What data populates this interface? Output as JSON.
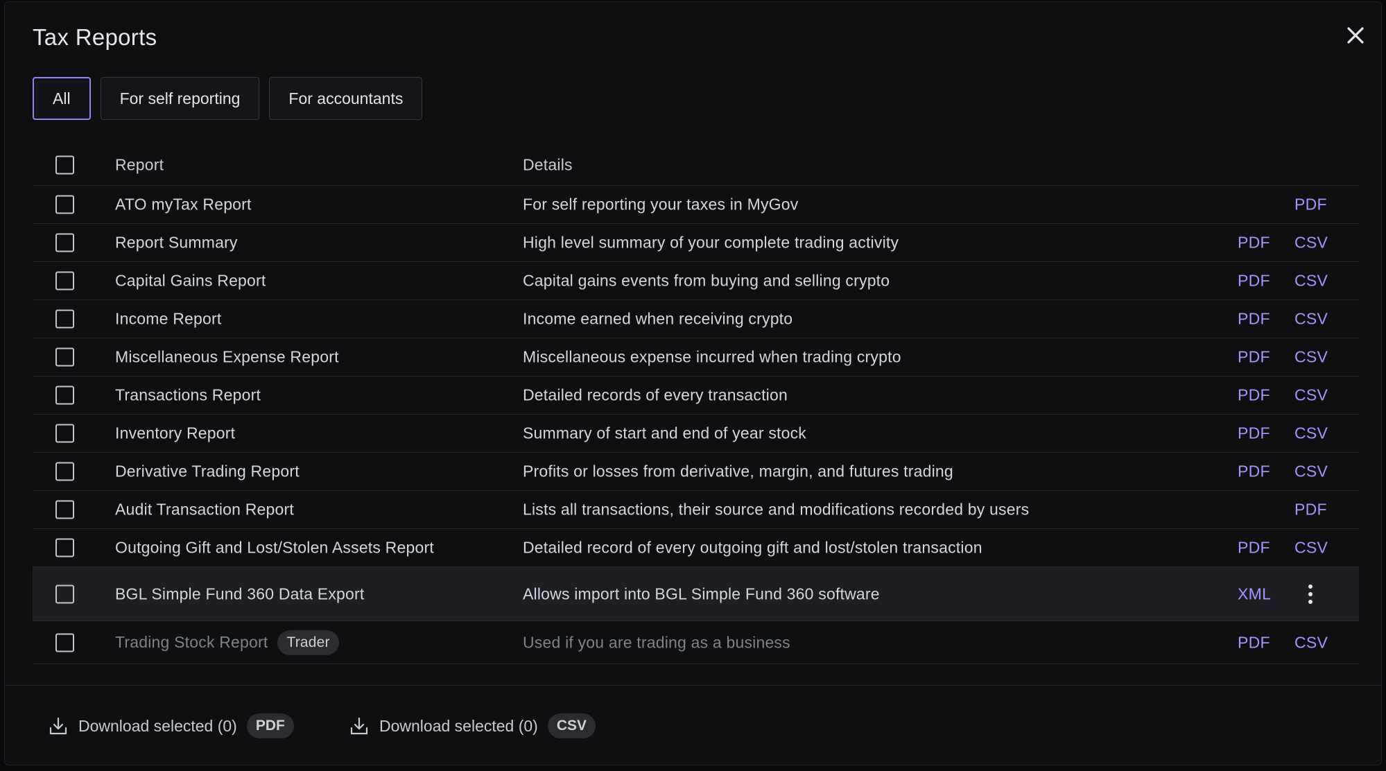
{
  "dialog": {
    "title": "Tax Reports"
  },
  "tabs": [
    {
      "label": "All",
      "active": true
    },
    {
      "label": "For self reporting",
      "active": false
    },
    {
      "label": "For accountants",
      "active": false
    }
  ],
  "table": {
    "headers": {
      "report": "Report",
      "details": "Details"
    },
    "rows": [
      {
        "name": "ATO myTax Report",
        "details": "For self reporting your taxes in MyGov",
        "formats": [
          "PDF"
        ]
      },
      {
        "name": "Report Summary",
        "details": "High level summary of your complete trading activity",
        "formats": [
          "PDF",
          "CSV"
        ]
      },
      {
        "name": "Capital Gains Report",
        "details": "Capital gains events from buying and selling crypto",
        "formats": [
          "PDF",
          "CSV"
        ]
      },
      {
        "name": "Income Report",
        "details": "Income earned when receiving crypto",
        "formats": [
          "PDF",
          "CSV"
        ]
      },
      {
        "name": "Miscellaneous Expense Report",
        "details": "Miscellaneous expense incurred when trading crypto",
        "formats": [
          "PDF",
          "CSV"
        ]
      },
      {
        "name": "Transactions Report",
        "details": "Detailed records of every transaction",
        "formats": [
          "PDF",
          "CSV"
        ]
      },
      {
        "name": "Inventory Report",
        "details": "Summary of start and end of year stock",
        "formats": [
          "PDF",
          "CSV"
        ]
      },
      {
        "name": "Derivative Trading Report",
        "details": "Profits or losses from derivative, margin, and futures trading",
        "formats": [
          "PDF",
          "CSV"
        ]
      },
      {
        "name": "Audit Transaction Report",
        "details": "Lists all transactions, their source and modifications recorded by users",
        "formats": [
          "PDF"
        ]
      },
      {
        "name": "Outgoing Gift and Lost/Stolen Assets Report",
        "details": "Detailed record of every outgoing gift and lost/stolen transaction",
        "formats": [
          "PDF",
          "CSV"
        ]
      },
      {
        "name": "BGL Simple Fund 360 Data Export",
        "details": "Allows import into BGL Simple Fund 360 software",
        "formats": [
          "XML"
        ],
        "highlighted": true
      },
      {
        "name": "Trading Stock Report",
        "badge": "Trader",
        "details": "Used if you are trading as a business",
        "formats": [
          "PDF",
          "CSV"
        ],
        "muted": true
      }
    ]
  },
  "footer": {
    "download_label": "Download selected (0)",
    "pdf_badge": "PDF",
    "csv_badge": "CSV"
  },
  "colors": {
    "accent": "#a496ff",
    "active_tab_border": "#8f86f0",
    "background": "#0e0f11"
  }
}
